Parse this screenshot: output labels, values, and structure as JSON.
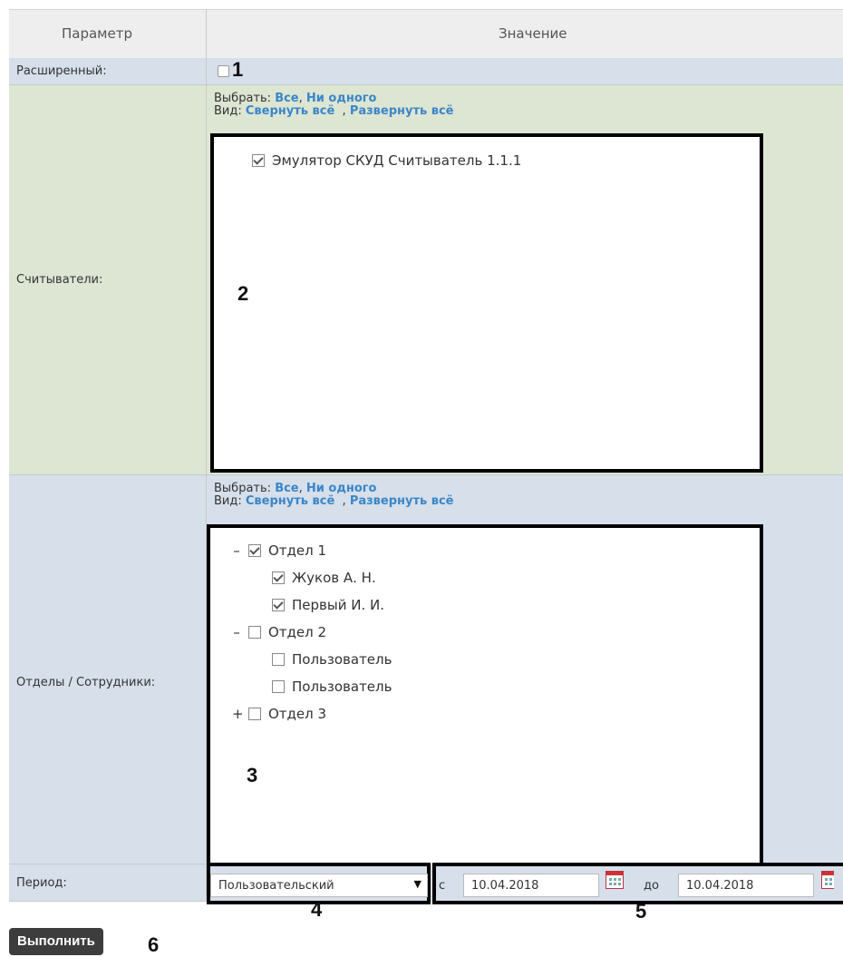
{
  "header": {
    "param": "Параметр",
    "value": "Значение"
  },
  "extended": {
    "label": "Расширенный:",
    "callout": "1"
  },
  "readers": {
    "label": "Считыватели:",
    "select_prefix": "Выбрать:",
    "select_all": "Все",
    "select_none": "Ни одного",
    "view_prefix": "Вид:",
    "collapse_all": "Свернуть всё",
    "expand_all": "Развернуть всё",
    "items": [
      {
        "label": "Эмулятор СКУД Считыватель 1.1.1",
        "checked": true
      }
    ],
    "callout": "2"
  },
  "departments": {
    "label": "Отделы / Сотрудники:",
    "select_prefix": "Выбрать:",
    "select_all": "Все",
    "select_none": "Ни одного",
    "view_prefix": "Вид:",
    "collapse_all": "Свернуть всё",
    "expand_all": "Развернуть всё",
    "tree": [
      {
        "toggle": "–",
        "label": "Отдел 1",
        "checked": true
      },
      {
        "label": "Жуков А. Н.",
        "checked": true
      },
      {
        "label": "Первый И. И.",
        "checked": true
      },
      {
        "toggle": "–",
        "label": "Отдел 2",
        "checked": false
      },
      {
        "label": "Пользователь",
        "checked": false
      },
      {
        "label": "Пользователь",
        "checked": false
      },
      {
        "toggle": "+",
        "label": "Отдел 3",
        "checked": false
      }
    ],
    "callout": "3"
  },
  "period": {
    "label": "Период:",
    "selected": "Пользовательский",
    "from_label": "с",
    "from_date": "10.04.2018",
    "to_label": "до",
    "to_date": "10.04.2018",
    "callout_select": "4",
    "callout_dates": "5"
  },
  "run": {
    "label": "Выполнить",
    "callout": "6"
  }
}
